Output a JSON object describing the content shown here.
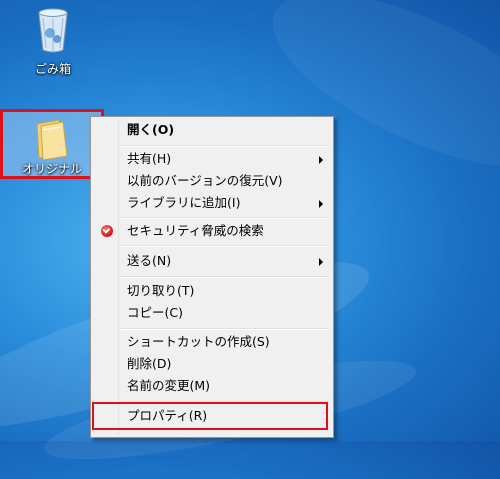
{
  "desktop": {
    "recycle_bin": {
      "label": "ごみ箱",
      "icon": "recycle-bin-icon"
    },
    "folder": {
      "label": "オリジナル",
      "icon": "folder-icon",
      "highlight_color": "#e0101a"
    }
  },
  "context_menu": {
    "items": [
      {
        "label": "開く(O)",
        "bold": true
      },
      {
        "label": "共有(H)",
        "submenu": true
      },
      {
        "label": "以前のバージョンの復元(V)"
      },
      {
        "label": "ライブラリに追加(I)",
        "submenu": true
      },
      {
        "label": "セキュリティ脅威の検索",
        "icon": "security-scan-icon"
      },
      {
        "label": "送る(N)",
        "submenu": true
      },
      {
        "label": "切り取り(T)"
      },
      {
        "label": "コピー(C)"
      },
      {
        "label": "ショートカットの作成(S)"
      },
      {
        "label": "削除(D)"
      },
      {
        "label": "名前の変更(M)"
      },
      {
        "label": "プロパティ(R)",
        "highlighted": true
      }
    ]
  },
  "colors": {
    "wallpaper": "#1f7fd4",
    "menu_bg": "#f0f0f0",
    "highlight": "#e0101a"
  }
}
